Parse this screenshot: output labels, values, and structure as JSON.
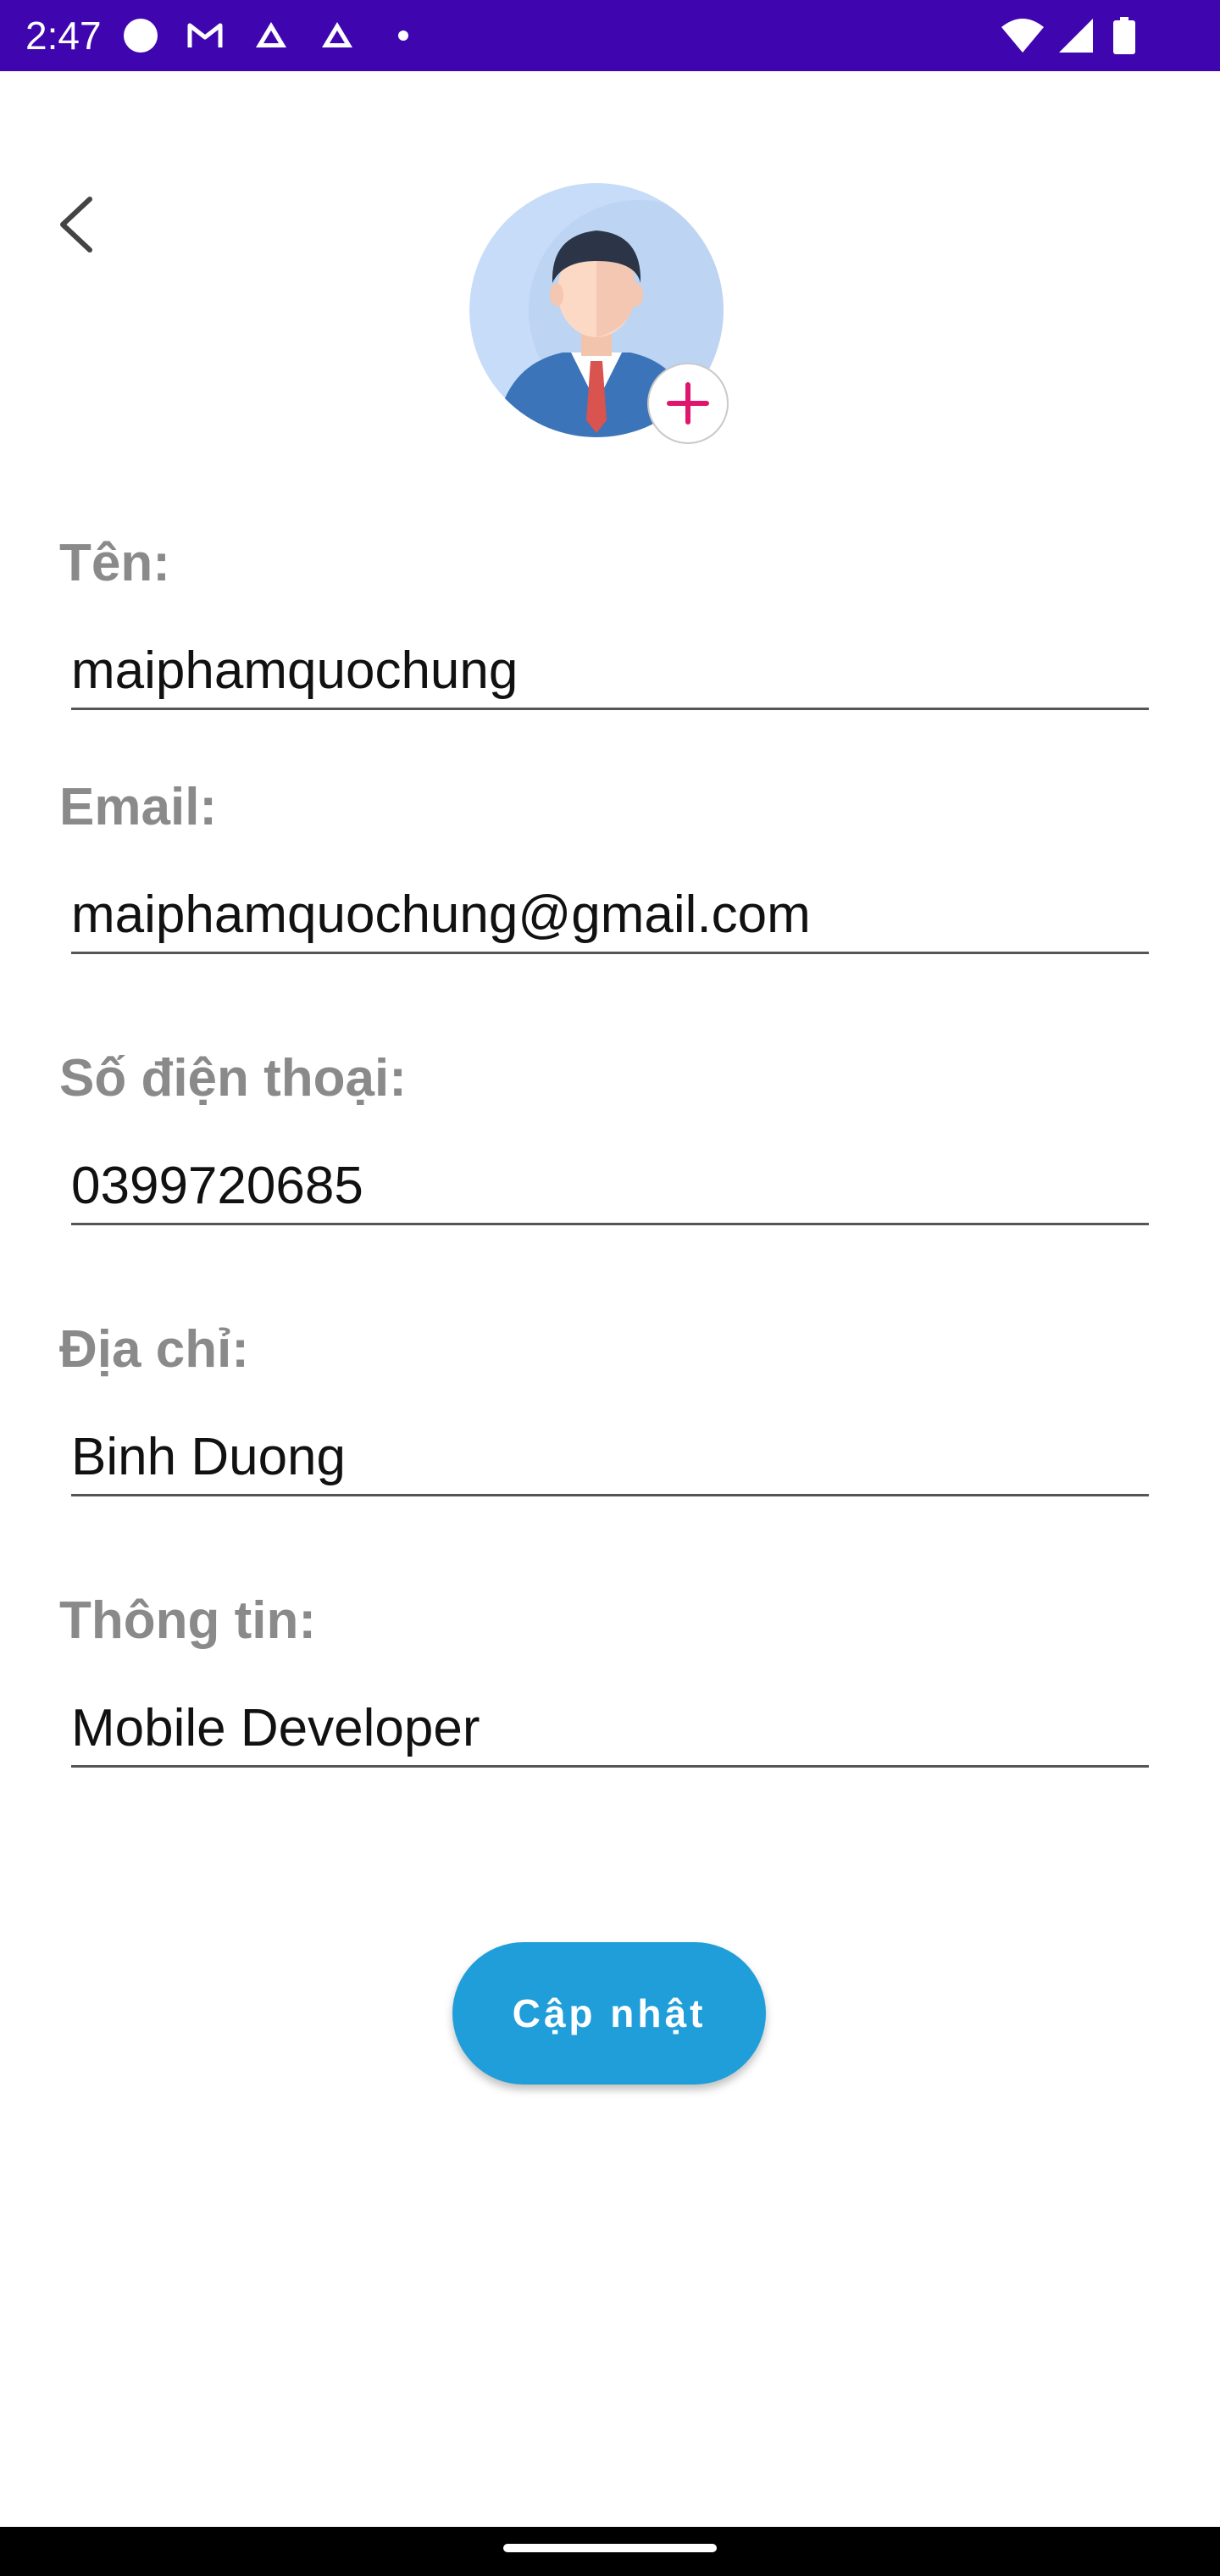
{
  "status_bar": {
    "time": "2:47",
    "icons": [
      "circle-notification-icon",
      "gmail-icon",
      "drive-icon",
      "drive-icon",
      "dot-icon"
    ],
    "right_icons": [
      "wifi-icon",
      "signal-icon",
      "battery-icon"
    ],
    "background": "#3f06b0"
  },
  "header": {
    "back_icon": "chevron-left-icon",
    "avatar_icon": "avatar-icon",
    "add_photo_icon": "plus-icon"
  },
  "form": {
    "name": {
      "label": "Tên:",
      "value": "maiphamquochung"
    },
    "email": {
      "label": "Email:",
      "value": "maiphamquochung@gmail.com"
    },
    "phone": {
      "label": "Số điện thoại:",
      "value": "0399720685"
    },
    "address": {
      "label": "Địa chỉ:",
      "value": "Binh Duong"
    },
    "info": {
      "label": "Thông tin:",
      "value": "Mobile Developer"
    }
  },
  "actions": {
    "update_label": "Cập nhật",
    "accent": "#1f9ed9",
    "add_icon_color": "#e0166e"
  }
}
